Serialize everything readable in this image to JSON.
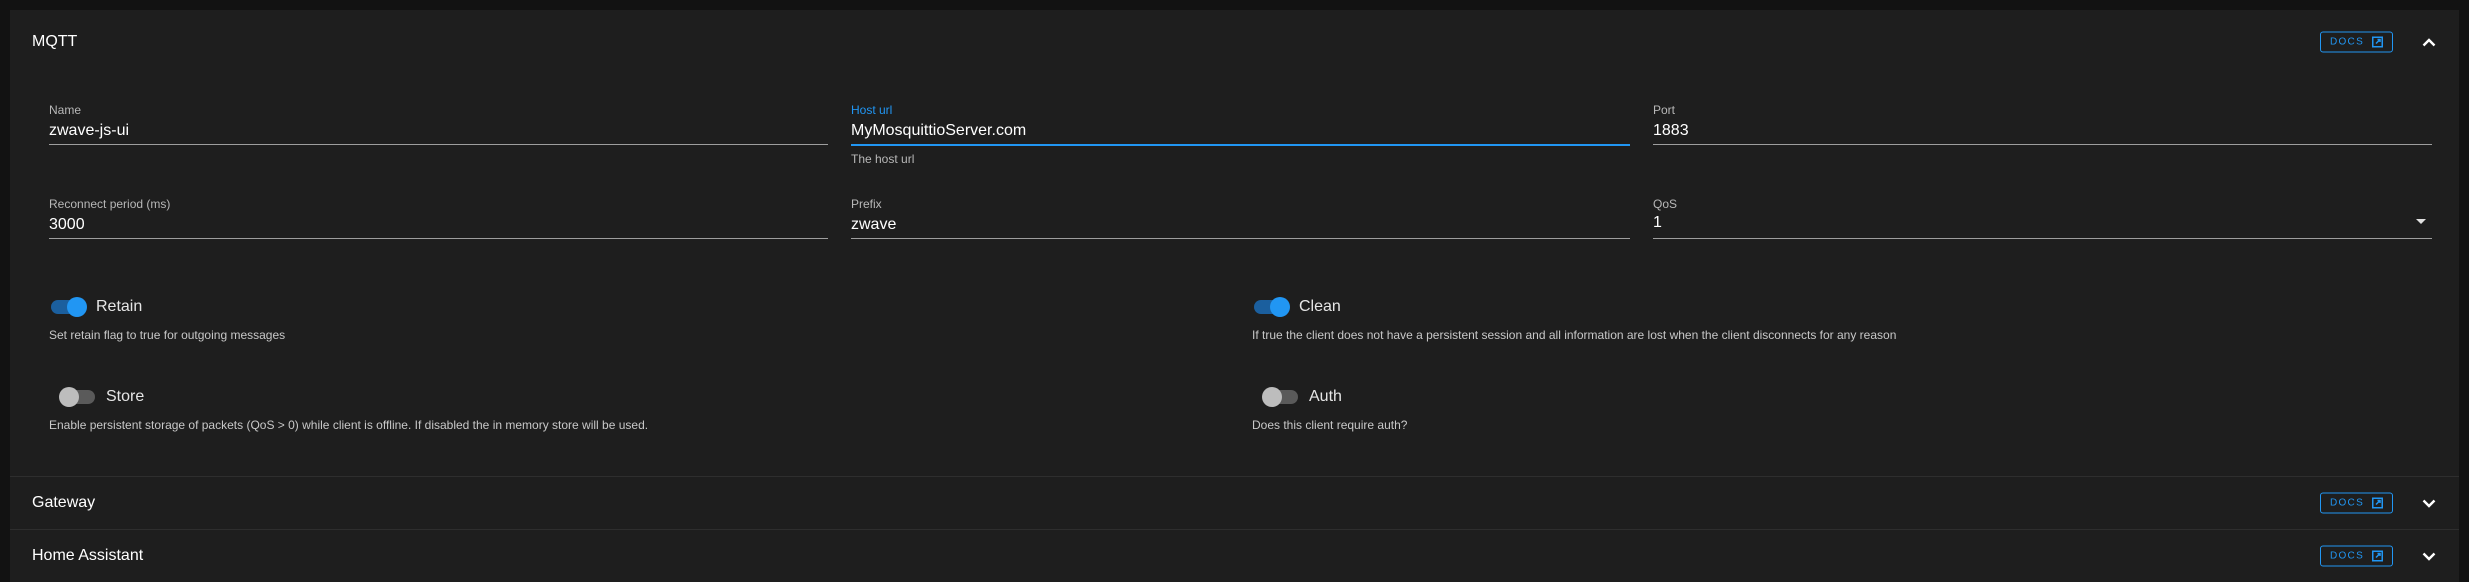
{
  "panels": {
    "mqtt": {
      "title": "MQTT",
      "docs_label": "DOCS",
      "fields": {
        "name": {
          "label": "Name",
          "value": "zwave-js-ui"
        },
        "host": {
          "label": "Host url",
          "value": "MyMosquittioServer.com",
          "hint": "The host url"
        },
        "port": {
          "label": "Port",
          "value": "1883"
        },
        "reconnect": {
          "label": "Reconnect period (ms)",
          "value": "3000"
        },
        "prefix": {
          "label": "Prefix",
          "value": "zwave"
        },
        "qos": {
          "label": "QoS",
          "value": "1"
        }
      },
      "switches": {
        "retain": {
          "label": "Retain",
          "on": true,
          "description": "Set retain flag to true for outgoing messages"
        },
        "clean": {
          "label": "Clean",
          "on": true,
          "description": "If true the client does not have a persistent session and all information are lost when the client disconnects for any reason"
        },
        "store": {
          "label": "Store",
          "on": false,
          "description": "Enable persistent storage of packets (QoS > 0) while client is offline. If disabled the in memory store will be used."
        },
        "auth": {
          "label": "Auth",
          "on": false,
          "description": "Does this client require auth?"
        }
      }
    },
    "gateway": {
      "title": "Gateway",
      "docs_label": "DOCS"
    },
    "home_assistant": {
      "title": "Home Assistant",
      "docs_label": "DOCS"
    }
  },
  "colors": {
    "accent": "#2196f3",
    "panel_bg": "#1e1e1e",
    "page_bg": "#121212"
  },
  "icons": {
    "docs": "open-in-new-icon",
    "expanded": "chevron-up-icon",
    "collapsed": "chevron-down-icon",
    "select": "menu-down-icon"
  }
}
